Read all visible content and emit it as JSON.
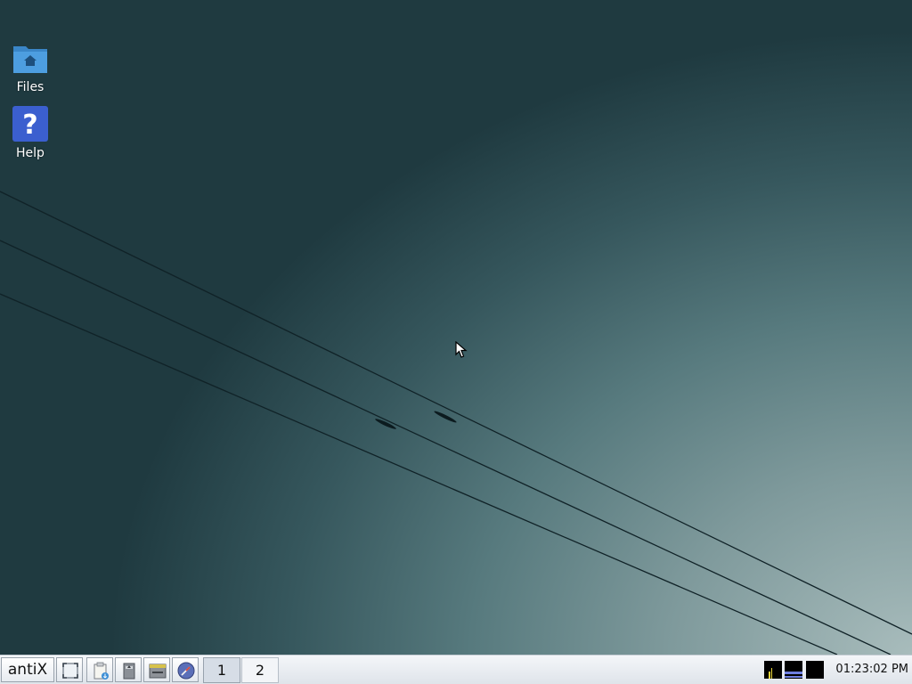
{
  "desktop": {
    "icons": [
      {
        "label": "Files",
        "icon": "home-folder-icon"
      },
      {
        "label": "Help",
        "icon": "help-question-icon"
      }
    ]
  },
  "taskbar": {
    "start_label": "antiX",
    "quick_launch": [
      {
        "icon": "show-desktop-icon"
      },
      {
        "icon": "clipboard-install-icon"
      },
      {
        "icon": "file-manager-icon"
      },
      {
        "icon": "terminal-icon"
      },
      {
        "icon": "web-browser-icon"
      }
    ],
    "workspaces": [
      "1",
      "2"
    ],
    "active_workspace": "1",
    "tray": [
      {
        "icon": "cpu-monitor-icon"
      },
      {
        "icon": "network-monitor-icon"
      },
      {
        "icon": "volume-monitor-icon"
      }
    ],
    "clock": "01:23:02 PM"
  },
  "colors": {
    "taskbar_bg": "#e6eaef",
    "desktop_dark": "#1f3a40",
    "desktop_light": "#a8bcbc"
  }
}
